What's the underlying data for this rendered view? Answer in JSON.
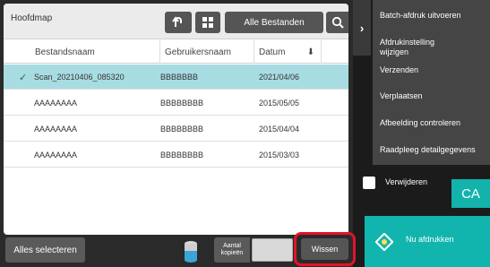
{
  "header": {
    "folder_title": "Hoofdmap",
    "all_files_label": "Alle Bestanden"
  },
  "table": {
    "columns": [
      "Bestandsnaam",
      "Gebruikersnaam",
      "Datum"
    ],
    "rows": [
      {
        "name": "Scan_20210406_085320",
        "user": "BBBBBBB",
        "date": "2021/04/06",
        "selected": true
      },
      {
        "name": "AAAAAAAA",
        "user": "BBBBBBBB",
        "date": "2015/05/05",
        "selected": false
      },
      {
        "name": "AAAAAAAA",
        "user": "BBBBBBBB",
        "date": "2015/04/04",
        "selected": false
      },
      {
        "name": "AAAAAAAA",
        "user": "BBBBBBBB",
        "date": "2015/03/03",
        "selected": false
      }
    ]
  },
  "footer": {
    "select_all_label": "Alles selecteren",
    "copies_label_1": "Aantal",
    "copies_label_2": "kopieën",
    "copies_value": "",
    "clear_label": "Wissen"
  },
  "menu": {
    "items": [
      {
        "line1": "Batch-afdruk uitvoeren",
        "line2": ""
      },
      {
        "line1": "Afdrukinstelling",
        "line2": "wijzigen"
      },
      {
        "line1": "Verzenden",
        "line2": ""
      },
      {
        "line1": "Verplaatsen",
        "line2": ""
      },
      {
        "line1": "Afbeelding controleren",
        "line2": ""
      },
      {
        "line1": "Raadpleeg detailgegevens",
        "line2": ""
      }
    ]
  },
  "actions": {
    "delete_label": "Verwijderen",
    "ca_label": "CA",
    "print_label": "Nu afdrukken"
  },
  "colors": {
    "accent_teal": "#12b5ae",
    "selected_row": "#a8dce3",
    "highlight_ring": "#e01428"
  },
  "icons": [
    "back-icon",
    "grid-view-icon",
    "search-icon",
    "sort-down-icon",
    "checkmark-icon",
    "toner-icon",
    "expand-arrow-icon",
    "print-diamond-icon"
  ]
}
